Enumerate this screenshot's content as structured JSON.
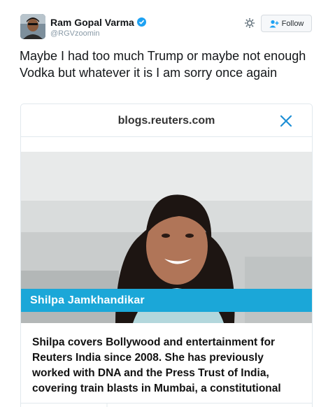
{
  "user": {
    "display_name": "Ram Gopal Varma",
    "handle": "@RGVzoomin",
    "verified": true
  },
  "actions": {
    "follow_label": "Follow",
    "settings_icon": "gear-icon",
    "follow_icon": "add-user-icon"
  },
  "tweet": {
    "text": "Maybe I had too much Trump or maybe not enough Vodka but whatever it is I am sorry once again"
  },
  "card": {
    "domain": "blogs.reuters.com",
    "close_icon": "close-x-icon",
    "person_name": "Shilpa Jamkhandikar",
    "bio_lines": [
      "Shilpa covers Bollywood and entertainment for",
      "Reuters India since 2008. She has previously",
      "worked with DNA and the Press Trust of India,",
      "covering train blasts in Mumbai, a constitutional"
    ]
  },
  "colors": {
    "accent": "#1da1f2",
    "banner": "#1ba7d8",
    "text": "#14171a",
    "muted": "#8899a6"
  }
}
